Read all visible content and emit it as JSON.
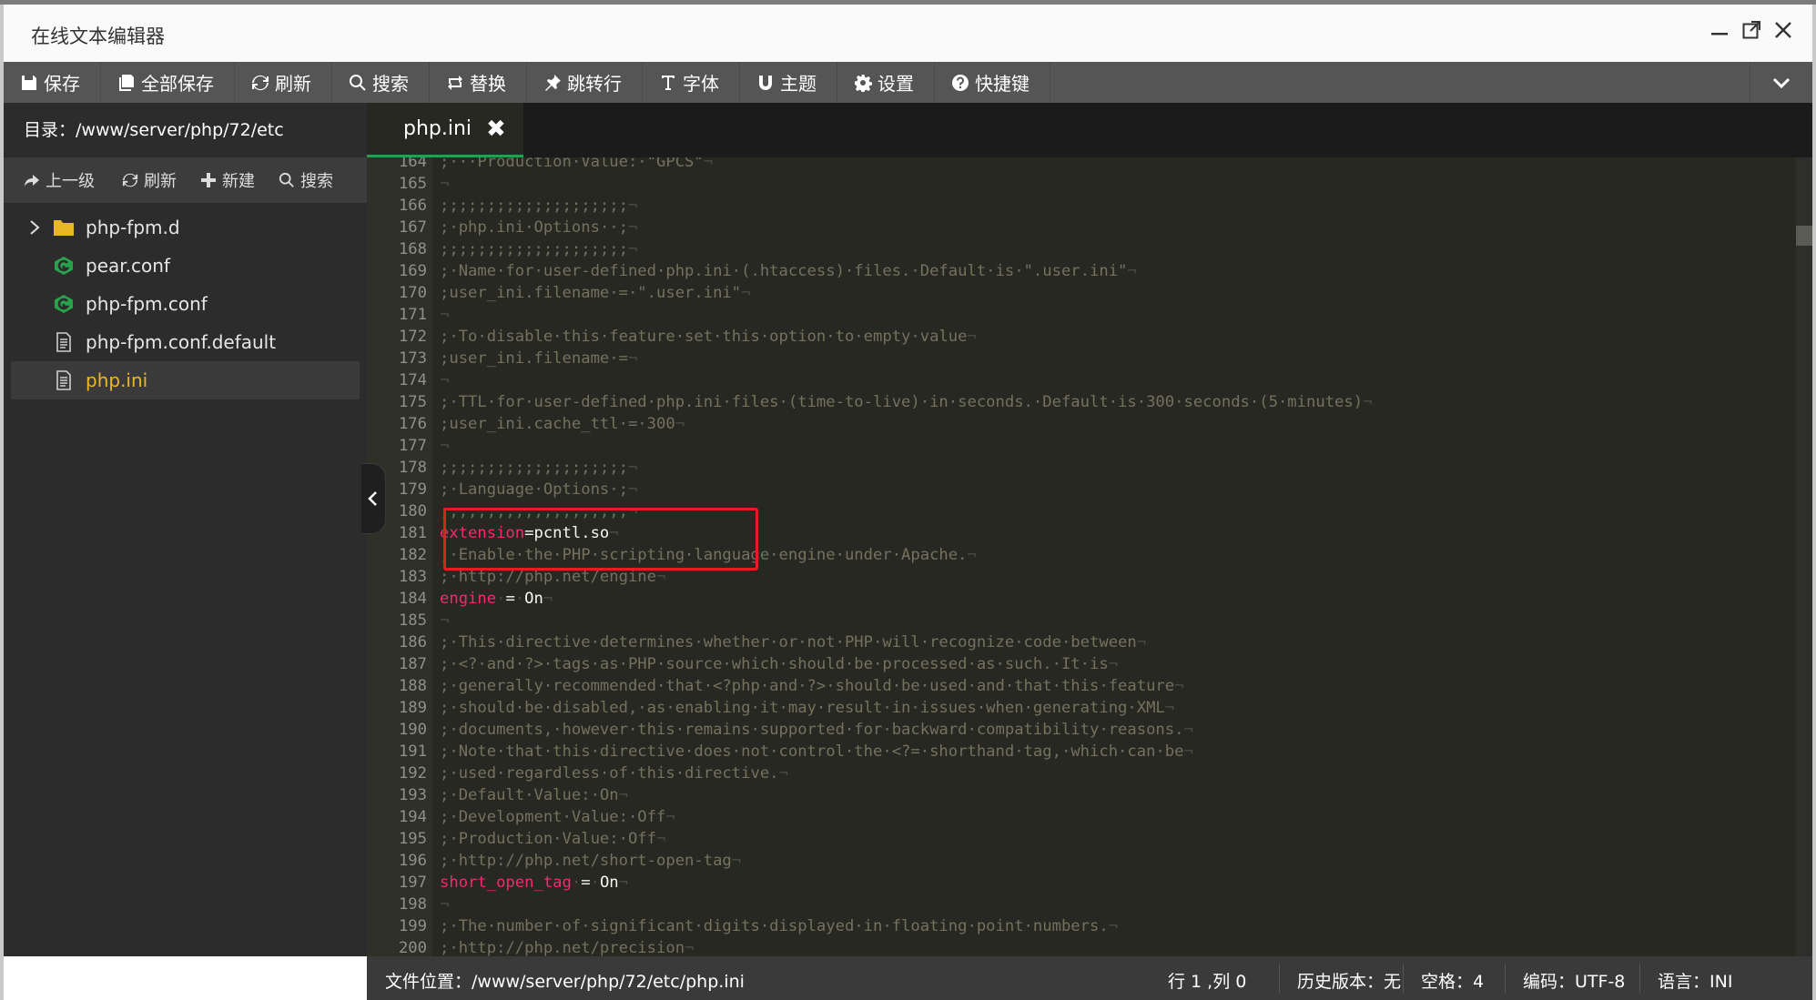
{
  "window": {
    "title": "在线文本编辑器"
  },
  "toolbar": {
    "items": [
      {
        "label": "保存",
        "icon": "save-icon"
      },
      {
        "label": "全部保存",
        "icon": "save-all-icon"
      },
      {
        "label": "刷新",
        "icon": "refresh-icon"
      },
      {
        "label": "搜索",
        "icon": "search-icon"
      },
      {
        "label": "替换",
        "icon": "replace-icon"
      },
      {
        "label": "跳转行",
        "icon": "pin-icon"
      },
      {
        "label": "字体",
        "icon": "font-icon"
      },
      {
        "label": "主题",
        "icon": "theme-icon"
      },
      {
        "label": "设置",
        "icon": "gear-icon"
      },
      {
        "label": "快捷键",
        "icon": "help-icon"
      }
    ]
  },
  "sidebar": {
    "directory": "目录：/www/server/php/72/etc",
    "actions": [
      {
        "label": "上一级",
        "icon": "share-arrow-icon"
      },
      {
        "label": "刷新",
        "icon": "refresh-icon"
      },
      {
        "label": "新建",
        "icon": "plus-icon"
      },
      {
        "label": "搜索",
        "icon": "search-icon"
      }
    ],
    "files": [
      {
        "name": "php-fpm.d",
        "type": "folder"
      },
      {
        "name": "pear.conf",
        "type": "conf"
      },
      {
        "name": "php-fpm.conf",
        "type": "conf"
      },
      {
        "name": "php-fpm.conf.default",
        "type": "text"
      },
      {
        "name": "php.ini",
        "type": "text",
        "selected": true
      }
    ]
  },
  "editor": {
    "tab": {
      "name": "php.ini",
      "close": "✖"
    },
    "lines": [
      {
        "n": "164",
        "parts": [
          [
            "c",
            ";···Production·Value:·\"GPCS\""
          ],
          [
            "e",
            "¬"
          ]
        ]
      },
      {
        "n": "165",
        "parts": [
          [
            "e",
            "¬"
          ]
        ]
      },
      {
        "n": "166",
        "parts": [
          [
            "c",
            ";;;;;;;;;;;;;;;;;;;;"
          ],
          [
            "e",
            "¬"
          ]
        ]
      },
      {
        "n": "167",
        "parts": [
          [
            "c",
            ";·php.ini·Options··;"
          ],
          [
            "e",
            "¬"
          ]
        ]
      },
      {
        "n": "168",
        "parts": [
          [
            "c",
            ";;;;;;;;;;;;;;;;;;;;"
          ],
          [
            "e",
            "¬"
          ]
        ]
      },
      {
        "n": "169",
        "parts": [
          [
            "c",
            ";·Name·for·user-defined·php.ini·(.htaccess)·files.·Default·is·\".user.ini\""
          ],
          [
            "e",
            "¬"
          ]
        ]
      },
      {
        "n": "170",
        "parts": [
          [
            "c",
            ";user_ini.filename·=·\".user.ini\""
          ],
          [
            "e",
            "¬"
          ]
        ]
      },
      {
        "n": "171",
        "parts": [
          [
            "e",
            "¬"
          ]
        ]
      },
      {
        "n": "172",
        "parts": [
          [
            "c",
            ";·To·disable·this·feature·set·this·option·to·empty·value"
          ],
          [
            "e",
            "¬"
          ]
        ]
      },
      {
        "n": "173",
        "parts": [
          [
            "c",
            ";user_ini.filename·="
          ],
          [
            "e",
            "¬"
          ]
        ]
      },
      {
        "n": "174",
        "parts": [
          [
            "e",
            "¬"
          ]
        ]
      },
      {
        "n": "175",
        "parts": [
          [
            "c",
            ";·TTL·for·user-defined·php.ini·files·(time-to-live)·in·seconds.·Default·is·300·seconds·(5·minutes)"
          ],
          [
            "e",
            "¬"
          ]
        ]
      },
      {
        "n": "176",
        "parts": [
          [
            "c",
            ";user_ini.cache_ttl·=·300"
          ],
          [
            "e",
            "¬"
          ]
        ]
      },
      {
        "n": "177",
        "parts": [
          [
            "e",
            "¬"
          ]
        ]
      },
      {
        "n": "178",
        "parts": [
          [
            "c",
            ";;;;;;;;;;;;;;;;;;;;"
          ],
          [
            "e",
            "¬"
          ]
        ]
      },
      {
        "n": "179",
        "parts": [
          [
            "c",
            ";·Language·Options·;"
          ],
          [
            "e",
            "¬"
          ]
        ]
      },
      {
        "n": "180",
        "parts": [
          [
            "c",
            ";;;;;;;;;;;;;;;;;;;;"
          ],
          [
            "e",
            "¬"
          ]
        ]
      },
      {
        "n": "181",
        "parts": [
          [
            "k",
            "extension"
          ],
          [
            "w",
            "=pcntl.so"
          ],
          [
            "e",
            "¬"
          ]
        ]
      },
      {
        "n": "182",
        "parts": [
          [
            "c",
            ";·Enable·the·PHP·scripting·language·engine·under·Apache."
          ],
          [
            "e",
            "¬"
          ]
        ]
      },
      {
        "n": "183",
        "parts": [
          [
            "c",
            ";·http://php.net/engine"
          ],
          [
            "e",
            "¬"
          ]
        ]
      },
      {
        "n": "184",
        "parts": [
          [
            "k",
            "engine"
          ],
          [
            "e",
            "·"
          ],
          [
            "w",
            "="
          ],
          [
            "e",
            "·"
          ],
          [
            "w",
            "On"
          ],
          [
            "e",
            "¬"
          ]
        ]
      },
      {
        "n": "185",
        "parts": [
          [
            "e",
            "¬"
          ]
        ]
      },
      {
        "n": "186",
        "parts": [
          [
            "c",
            ";·This·directive·determines·whether·or·not·PHP·will·recognize·code·between"
          ],
          [
            "e",
            "¬"
          ]
        ]
      },
      {
        "n": "187",
        "parts": [
          [
            "c",
            ";·<?·and·?>·tags·as·PHP·source·which·should·be·processed·as·such.·It·is"
          ],
          [
            "e",
            "¬"
          ]
        ]
      },
      {
        "n": "188",
        "parts": [
          [
            "c",
            ";·generally·recommended·that·<?php·and·?>·should·be·used·and·that·this·feature"
          ],
          [
            "e",
            "¬"
          ]
        ]
      },
      {
        "n": "189",
        "parts": [
          [
            "c",
            ";·should·be·disabled,·as·enabling·it·may·result·in·issues·when·generating·XML"
          ],
          [
            "e",
            "¬"
          ]
        ]
      },
      {
        "n": "190",
        "parts": [
          [
            "c",
            ";·documents,·however·this·remains·supported·for·backward·compatibility·reasons."
          ],
          [
            "e",
            "¬"
          ]
        ]
      },
      {
        "n": "191",
        "parts": [
          [
            "c",
            ";·Note·that·this·directive·does·not·control·the·<?=·shorthand·tag,·which·can·be"
          ],
          [
            "e",
            "¬"
          ]
        ]
      },
      {
        "n": "192",
        "parts": [
          [
            "c",
            ";·used·regardless·of·this·directive."
          ],
          [
            "e",
            "¬"
          ]
        ]
      },
      {
        "n": "193",
        "parts": [
          [
            "c",
            ";·Default·Value:·On"
          ],
          [
            "e",
            "¬"
          ]
        ]
      },
      {
        "n": "194",
        "parts": [
          [
            "c",
            ";·Development·Value:·Off"
          ],
          [
            "e",
            "¬"
          ]
        ]
      },
      {
        "n": "195",
        "parts": [
          [
            "c",
            ";·Production·Value:·Off"
          ],
          [
            "e",
            "¬"
          ]
        ]
      },
      {
        "n": "196",
        "parts": [
          [
            "c",
            ";·http://php.net/short-open-tag"
          ],
          [
            "e",
            "¬"
          ]
        ]
      },
      {
        "n": "197",
        "parts": [
          [
            "k",
            "short_open_tag"
          ],
          [
            "e",
            "·"
          ],
          [
            "w",
            "="
          ],
          [
            "e",
            "·"
          ],
          [
            "w",
            "On"
          ],
          [
            "e",
            "¬"
          ]
        ]
      },
      {
        "n": "198",
        "parts": [
          [
            "e",
            "¬"
          ]
        ]
      },
      {
        "n": "199",
        "parts": [
          [
            "c",
            ";·The·number·of·significant·digits·displayed·in·floating·point·numbers."
          ],
          [
            "e",
            "¬"
          ]
        ]
      },
      {
        "n": "200",
        "parts": [
          [
            "c",
            ";·http://php.net/precision"
          ],
          [
            "e",
            "¬"
          ]
        ]
      }
    ]
  },
  "status": {
    "file_path": "文件位置：/www/server/php/72/etc/php.ini",
    "cursor": "行 1 ,列 0",
    "history": "历史版本：无",
    "spaces": "空格：4",
    "encoding": "编码：UTF-8",
    "language": "语言：INI"
  },
  "colors": {
    "toolbar_bg": "#555555",
    "sidebar_bg": "#2c2c2c",
    "editor_bg": "#272822",
    "keyword": "#f92672",
    "comment": "#75715e",
    "selected_file": "#e9b824",
    "highlight_box": "#e0201e",
    "tab_underline": "#2a9d50"
  }
}
